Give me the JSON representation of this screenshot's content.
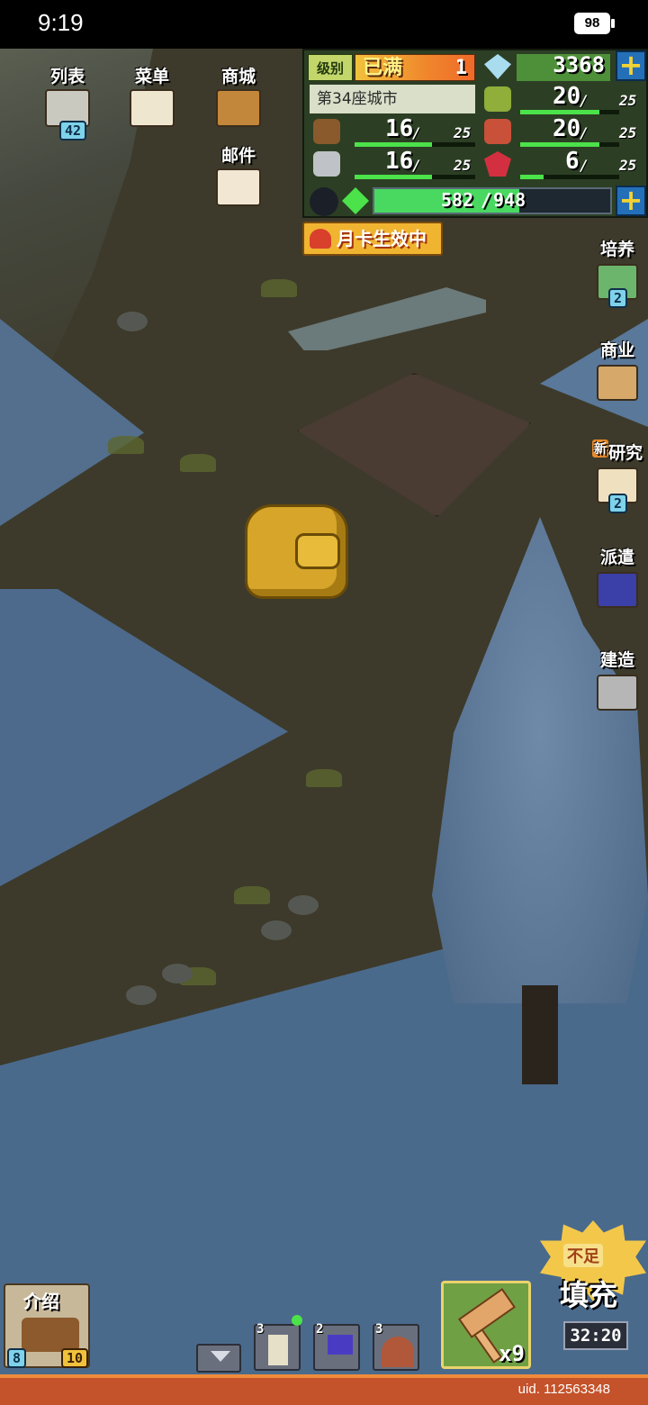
{
  "status_bar": {
    "time": "9:19",
    "battery": "98"
  },
  "top_menu": {
    "list": {
      "label": "列表",
      "badge": "42"
    },
    "menu": {
      "label": "菜单"
    },
    "shop": {
      "label": "商城"
    },
    "mail": {
      "label": "邮件"
    }
  },
  "resources": {
    "level_label": "级别",
    "level_value": "已满",
    "level_num": "1",
    "gems": "3368",
    "city_name": "第34座城市",
    "wood": {
      "value": "16",
      "cap": "25",
      "fill": 0.64
    },
    "ore": {
      "value": "16",
      "cap": "25",
      "fill": 0.64
    },
    "crop": {
      "value": "20",
      "cap": "25",
      "fill": 0.8
    },
    "food": {
      "value": "20",
      "cap": "25",
      "fill": 0.8
    },
    "ruby": {
      "value": "6",
      "cap": "25",
      "fill": 0.24
    },
    "exp": {
      "value": "582",
      "cap": "948",
      "fill": 0.614
    }
  },
  "month_card": "月卡生效中",
  "right_menu": {
    "train": {
      "label": "培养",
      "badge": "2"
    },
    "business": {
      "label": "商业"
    },
    "research": {
      "label": "研究",
      "new_tag": "新",
      "badge": "2"
    },
    "dispatch": {
      "label": "派遣"
    },
    "build": {
      "label": "建造"
    }
  },
  "bottom": {
    "intro": {
      "label": "介绍",
      "badge_left": "8",
      "badge_right": "10"
    },
    "slots": [
      "3",
      "2",
      "3"
    ],
    "hammer_count": "x9",
    "refill": {
      "tag": "不足",
      "label": "填充",
      "timer": "32:20"
    },
    "uid": "uid. 112563348"
  },
  "colors": {
    "accent_green": "#4be24a",
    "panel_bg": "#2c3f24",
    "plus_blue": "#2470b8",
    "bottom_orange": "#c4522a"
  }
}
